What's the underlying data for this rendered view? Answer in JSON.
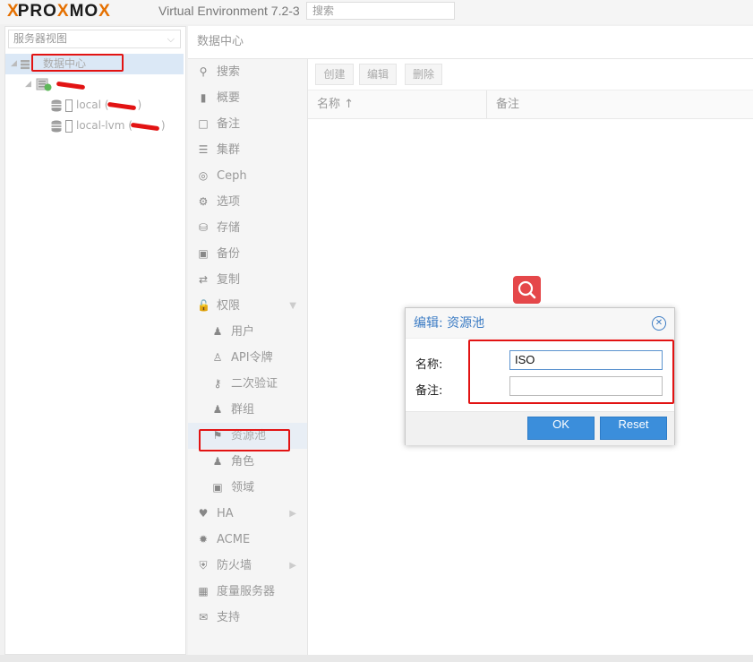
{
  "brand": {
    "x": "X",
    "name_p": "PRO",
    "name_x": "X",
    "name_mo": "MO",
    "name_x2": "X"
  },
  "header": {
    "version": "Virtual Environment 7.2-3",
    "search_placeholder": "搜索"
  },
  "resource_tree": {
    "view_selector": "服务器视图",
    "datacenter": "数据中心",
    "storages": [
      {
        "label": "local (",
        "tail": ")"
      },
      {
        "label": "local-lvm (",
        "tail": ")"
      }
    ]
  },
  "content": {
    "title": "数据中心",
    "nav": [
      {
        "icon": "search-icon",
        "label": "搜索"
      },
      {
        "icon": "book-icon",
        "label": "概要"
      },
      {
        "icon": "note-icon",
        "label": "备注"
      },
      {
        "icon": "cluster-icon",
        "label": "集群"
      },
      {
        "icon": "ceph-icon",
        "label": "Ceph"
      },
      {
        "icon": "gear-icon",
        "label": "选项"
      },
      {
        "icon": "database-icon",
        "label": "存储"
      },
      {
        "icon": "floppy-icon",
        "label": "备份"
      },
      {
        "icon": "retweet-icon",
        "label": "复制"
      },
      {
        "icon": "unlock-icon",
        "label": "权限"
      },
      {
        "icon": "user-icon",
        "label": "用户"
      },
      {
        "icon": "user-outline-icon",
        "label": "API令牌"
      },
      {
        "icon": "key-icon",
        "label": "二次验证"
      },
      {
        "icon": "users-icon",
        "label": "群组"
      },
      {
        "icon": "tags-icon",
        "label": "资源池"
      },
      {
        "icon": "male-icon",
        "label": "角色"
      },
      {
        "icon": "id-card-icon",
        "label": "领域"
      },
      {
        "icon": "heartbeat-icon",
        "label": "HA"
      },
      {
        "icon": "certificate-icon",
        "label": "ACME"
      },
      {
        "icon": "shield-icon",
        "label": "防火墙"
      },
      {
        "icon": "bar-chart-icon",
        "label": "度量服务器"
      },
      {
        "icon": "comments-icon",
        "label": "支持"
      }
    ],
    "toolbar": {
      "create": "创建",
      "edit": "编辑",
      "delete": "删除"
    },
    "columns": {
      "name": "名称 ↑",
      "comment": "备注"
    }
  },
  "dialog": {
    "title": "编辑: 资源池",
    "name_label": "名称:",
    "name_value": "ISO",
    "comment_label": "备注:",
    "comment_value": "",
    "ok": "OK",
    "reset": "Reset"
  },
  "colors": {
    "accent": "#3b8edb",
    "brand_orange": "#e57000",
    "annotation_red": "#e21313",
    "search_fab": "#e5474a"
  }
}
